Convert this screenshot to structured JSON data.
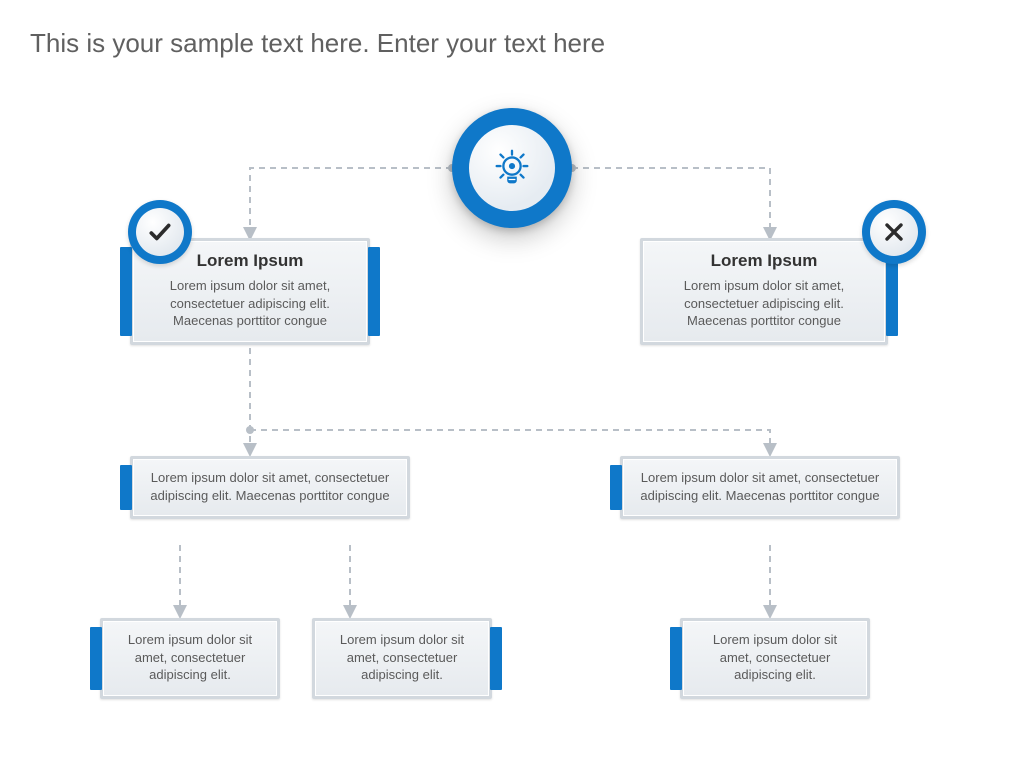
{
  "title": "This is your sample text here. Enter your text here",
  "nodes": {
    "left1": {
      "title": "Lorem Ipsum",
      "body": "Lorem ipsum dolor sit amet, consectetuer adipiscing elit. Maecenas porttitor congue"
    },
    "right1": {
      "title": "Lorem Ipsum",
      "body": "Lorem ipsum dolor sit amet, consectetuer adipiscing elit. Maecenas porttitor congue"
    },
    "mid_l": {
      "body": "Lorem ipsum dolor sit amet, consectetuer adipiscing elit. Maecenas porttitor congue"
    },
    "mid_r": {
      "body": "Lorem ipsum dolor sit amet, consectetuer adipiscing elit. Maecenas porttitor congue"
    },
    "bot_l1": {
      "body": "Lorem ipsum dolor sit amet, consectetuer adipiscing elit."
    },
    "bot_l2": {
      "body": "Lorem ipsum dolor sit amet, consectetuer adipiscing elit."
    },
    "bot_r": {
      "body": "Lorem ipsum dolor sit amet, consectetuer adipiscing elit."
    }
  },
  "colors": {
    "accent": "#0f78c9"
  }
}
